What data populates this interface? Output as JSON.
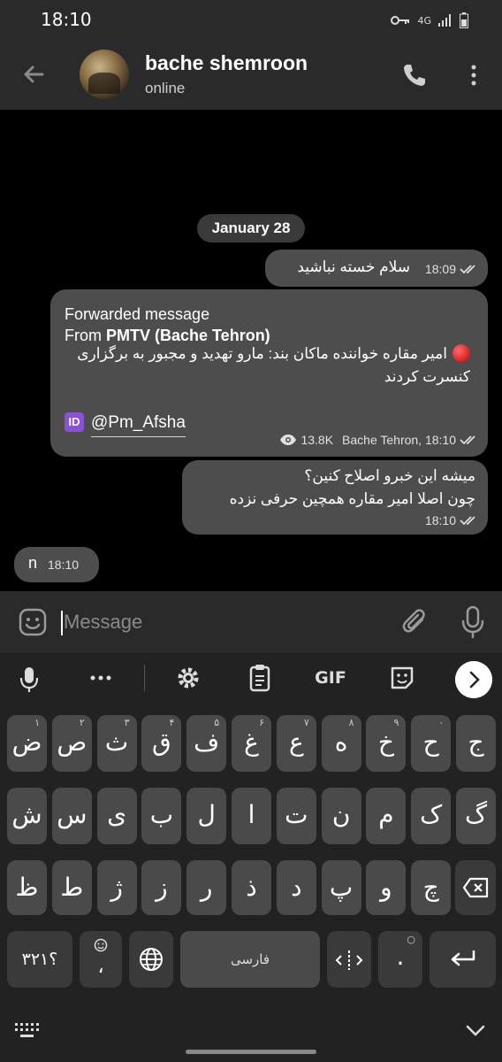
{
  "status_bar": {
    "time": "18:10",
    "icons": [
      "key-icon",
      "4g-icon",
      "signal-icon",
      "battery-icon"
    ],
    "network": "4G"
  },
  "header": {
    "name": "bache shemroon",
    "status": "online"
  },
  "chat": {
    "date": "January 28",
    "messages": [
      {
        "text": "سلام خسته نباشید",
        "time": "18:09"
      },
      {
        "forwarded_label": "Forwarded message",
        "from_prefix": "From ",
        "from_source": "PMTV (Bache Tehron)",
        "text": "امیر مقاره خواننده ماکان بند: مارو تهدید و مجبور به برگزاری کنسرت کردند",
        "handle": "@Pm_Afsha",
        "id_badge": "ID",
        "views": "13.8K",
        "meta": "Bache Tehron, 18:10"
      },
      {
        "line1": "میشه این خبرو اصلاح کنین؟",
        "line2": "چون اصلا امیر مقاره همچین حرفی نزده",
        "time": "18:10"
      },
      {
        "text": "n",
        "time": "18:10"
      }
    ]
  },
  "input": {
    "placeholder": "Message",
    "value": ""
  },
  "keyboard": {
    "toolbar": [
      "mic-icon",
      "more-icon",
      "settings-icon",
      "clipboard-icon",
      "gif-icon",
      "sticker-icon",
      "next-icon"
    ],
    "gif_label": "GIF",
    "row1": [
      {
        "ch": "ض",
        "sup": "۱"
      },
      {
        "ch": "ص",
        "sup": "۲"
      },
      {
        "ch": "ث",
        "sup": "۳"
      },
      {
        "ch": "ق",
        "sup": "۴"
      },
      {
        "ch": "ف",
        "sup": "۵"
      },
      {
        "ch": "غ",
        "sup": "۶"
      },
      {
        "ch": "ع",
        "sup": "۷"
      },
      {
        "ch": "ه",
        "sup": "۸"
      },
      {
        "ch": "خ",
        "sup": "۹"
      },
      {
        "ch": "ح",
        "sup": "۰"
      },
      {
        "ch": "ج",
        "sup": ""
      }
    ],
    "row2": [
      "ش",
      "س",
      "ی",
      "ب",
      "ل",
      "ا",
      "ت",
      "ن",
      "م",
      "ک",
      "گ"
    ],
    "row3": [
      "ظ",
      "ط",
      "ژ",
      "ز",
      "ر",
      "ذ",
      "د",
      "پ",
      "و",
      "چ"
    ],
    "row4": {
      "numbers": "؟۳۲۱",
      "comma": "،",
      "space": "فارسی",
      "period": "."
    },
    "colors": {
      "key": "#4a4a4a",
      "background": "#222222",
      "bubble": "#4d4d4d",
      "id_badge": "#8b4fd8",
      "red_dot": "#e01b1b"
    }
  }
}
